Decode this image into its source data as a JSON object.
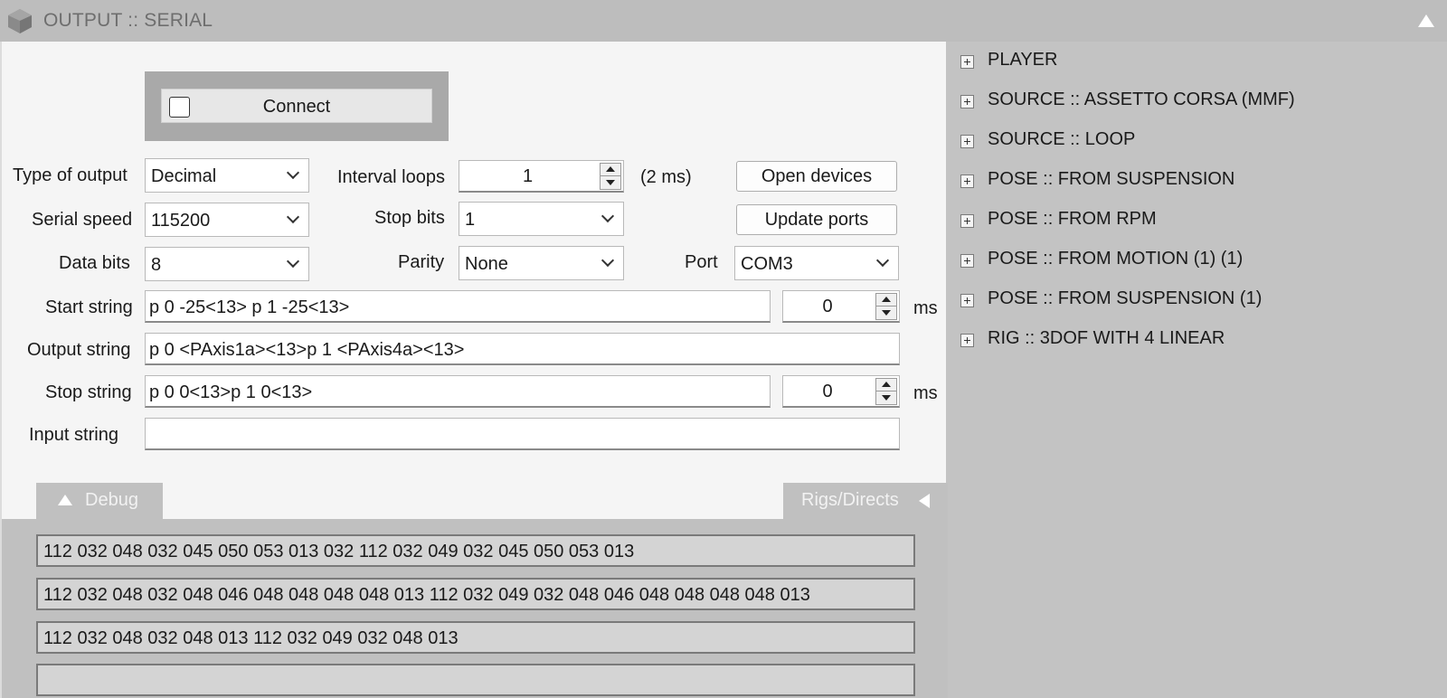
{
  "window": {
    "title": "OUTPUT :: SERIAL",
    "icon": "cube-icon",
    "collapse_icon": "triangle-up-icon"
  },
  "connect": {
    "label": "Connect",
    "checked": false
  },
  "form": {
    "type_of_output": {
      "label": "Type of output",
      "value": "Decimal"
    },
    "interval_loops": {
      "label": "Interval loops",
      "value": "1",
      "note": "(2 ms)"
    },
    "open_devices": "Open devices",
    "serial_speed": {
      "label": "Serial speed",
      "value": "115200"
    },
    "stop_bits": {
      "label": "Stop bits",
      "value": "1"
    },
    "update_ports": "Update ports",
    "data_bits": {
      "label": "Data bits",
      "value": "8"
    },
    "parity": {
      "label": "Parity",
      "value": "None"
    },
    "port": {
      "label": "Port",
      "value": "COM3"
    },
    "start_string": {
      "label": "Start string",
      "value": "p 0 -25<13> p 1 -25<13>",
      "delay": "0",
      "unit": "ms"
    },
    "output_string": {
      "label": "Output string",
      "value": "p 0 <PAxis1a><13>p 1 <PAxis4a><13>"
    },
    "stop_string": {
      "label": "Stop string",
      "value": "p 0 0<13>p 1 0<13>",
      "delay": "0",
      "unit": "ms"
    },
    "input_string": {
      "label": "Input string",
      "value": ""
    }
  },
  "tabs": {
    "debug": "Debug",
    "rigs_directs": "Rigs/Directs"
  },
  "debug_lines": [
    "112 032 048 032 045 050 053 013 032 112 032 049 032 045 050 053 013",
    "112 032 048 032 048 046 048 048 048 048 013 112 032 049 032 048 046 048 048 048 048 013",
    "112 032 048 032 048 013 112 032 049 032 048 013",
    ""
  ],
  "tree_items": [
    "PLAYER",
    "SOURCE :: ASSETTO CORSA (MMF)",
    "SOURCE :: LOOP",
    "POSE :: FROM SUSPENSION",
    "POSE :: FROM RPM",
    "POSE :: FROM MOTION (1) (1)",
    "POSE :: FROM SUSPENSION (1)",
    "RIG :: 3DOF WITH 4 LINEAR"
  ]
}
